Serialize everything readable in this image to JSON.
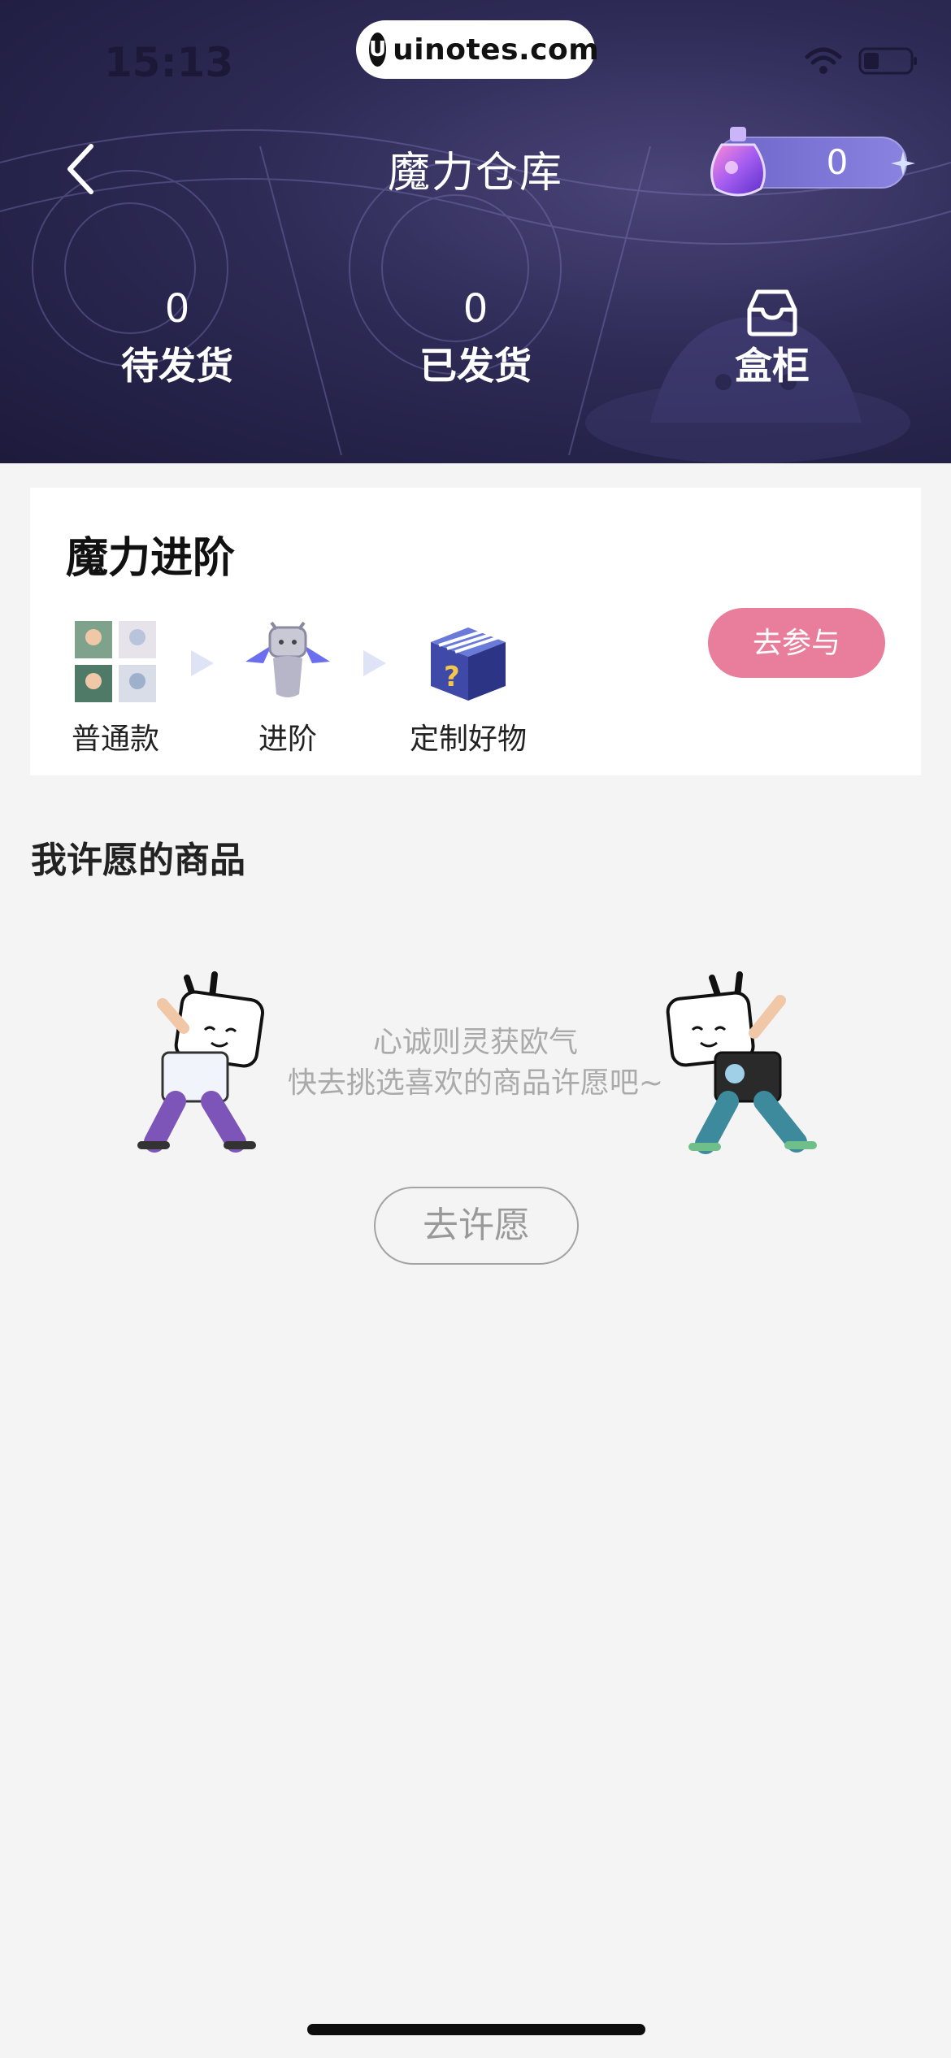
{
  "status_bar": {
    "time": "15:13"
  },
  "watermark": {
    "logo": "U",
    "text": "uinotes.com"
  },
  "nav": {
    "title": "魔力仓库",
    "magic_balance": "0"
  },
  "stats": [
    {
      "value": "0",
      "label": "待发货"
    },
    {
      "value": "0",
      "label": "已发货"
    },
    {
      "label": "盒柜",
      "icon": "box-icon"
    }
  ],
  "advance_card": {
    "title": "魔力进阶",
    "steps": [
      "普通款",
      "进阶",
      "定制好物"
    ],
    "join_label": "去参与"
  },
  "wish_section": {
    "title": "我许愿的商品",
    "empty_line1": "心诚则灵获欧气",
    "empty_line2": "快去挑选喜欢的商品许愿吧~",
    "button_label": "去许愿"
  },
  "colors": {
    "header_bg": "#2d2a55",
    "join_button": "#e87e9b",
    "magic_pill": "#7b74d6",
    "page_bg": "#f4f4f5"
  }
}
